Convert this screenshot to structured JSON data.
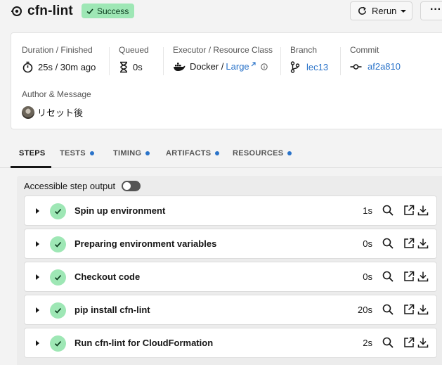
{
  "header": {
    "title": "cfn-lint",
    "status": "Success",
    "rerun_label": "Rerun",
    "more_label": "···"
  },
  "details": {
    "duration_label": "Duration / Finished",
    "duration_value": "25s / 30m ago",
    "queued_label": "Queued",
    "queued_value": "0s",
    "executor_label": "Executor / Resource Class",
    "executor_value": "Docker /",
    "resource_class": "Large",
    "branch_label": "Branch",
    "branch_value": "lec13",
    "commit_label": "Commit",
    "commit_value": "af2a810",
    "author_label": "Author & Message",
    "author_message": "リセット後"
  },
  "tabs": [
    {
      "label": "STEPS"
    },
    {
      "label": "TESTS"
    },
    {
      "label": "TIMING"
    },
    {
      "label": "ARTIFACTS"
    },
    {
      "label": "RESOURCES"
    }
  ],
  "steps_panel": {
    "toggle_label": "Accessible step output",
    "steps": [
      {
        "name": "Spin up environment",
        "duration": "1s"
      },
      {
        "name": "Preparing environment variables",
        "duration": "0s"
      },
      {
        "name": "Checkout code",
        "duration": "0s"
      },
      {
        "name": "pip install cfn-lint",
        "duration": "20s"
      },
      {
        "name": "Run cfn-lint for CloudFormation",
        "duration": "2s"
      }
    ]
  },
  "colors": {
    "success": "#9ee7b5",
    "link": "#2a73c9",
    "tab_dot": "#2a73c9"
  },
  "icons": {
    "job": "job-icon",
    "badge": "check-icon",
    "rerun": "refresh-icon",
    "duration": "stopwatch-icon",
    "queued": "hourglass-icon",
    "executor": "docker-icon",
    "branch": "git-branch-icon",
    "commit": "git-commit-icon"
  }
}
